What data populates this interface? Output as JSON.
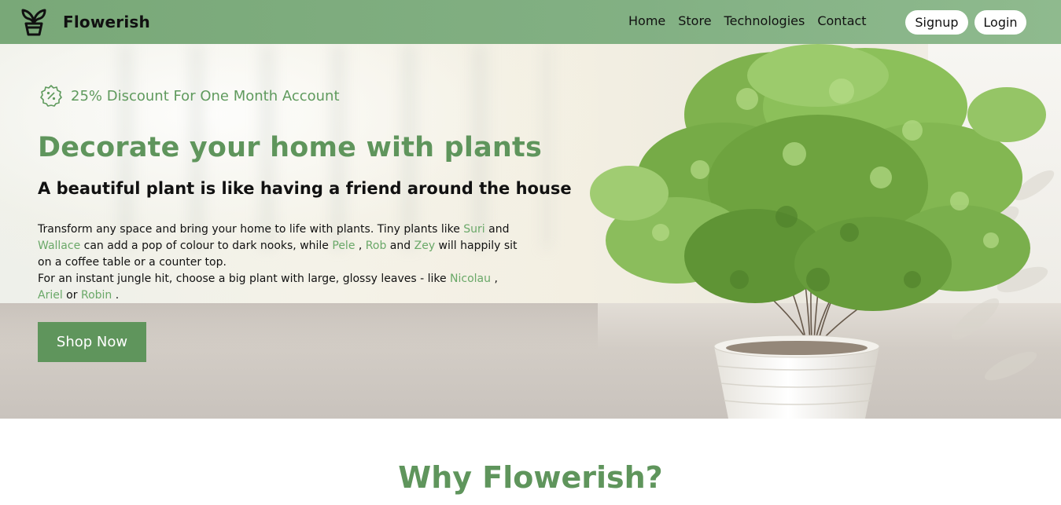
{
  "brand": {
    "name": "Flowerish",
    "logo_icon": "sprout-pot-icon"
  },
  "nav": {
    "links": [
      "Home",
      "Store",
      "Technologies",
      "Contact"
    ],
    "signup_label": "Signup",
    "login_label": "Login"
  },
  "hero": {
    "discount_icon": "discount-badge-icon",
    "discount_text": "25% Discount For One Month Account",
    "title": "Decorate your home with plants",
    "subtitle": "A beautiful plant is like having a friend around the house",
    "body": {
      "l1_a": "Transform any space and bring your home to life with plants. Tiny plants like ",
      "suri": "Suri",
      "l1_b": " and",
      "wallace": "Wallace",
      "l2_a": " can add a pop of colour to dark nooks, while ",
      "pele": "Pele",
      "sep1": " , ",
      "rob": "Rob",
      "and1": " and ",
      "zey": "Zey",
      "l2_b": " will happily sit",
      "l3": "on a coffee table or a counter top.",
      "l4_a": "For an instant jungle hit, choose a big plant with large, glossy leaves - like ",
      "nicolau": "Nicolau",
      "sep2": " ,",
      "ariel": "Ariel",
      "or1": " or ",
      "robin": "Robin",
      "end": " ."
    },
    "shop_label": "Shop Now"
  },
  "why": {
    "title": "Why Flowerish?"
  },
  "colors": {
    "accent": "#5f955c",
    "link": "#6aa868",
    "navbar": "#7fae7e"
  }
}
